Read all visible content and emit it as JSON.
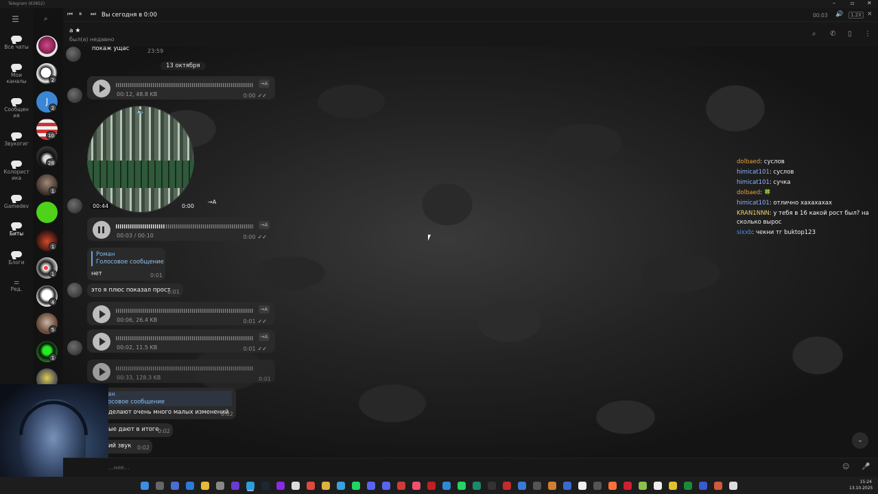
{
  "window": {
    "title": "Telegram (63852)",
    "minimize": "–",
    "maximize": "▫",
    "close": "✕"
  },
  "player": {
    "title": "Вы сегодня в 0:00",
    "elapsed": "00:03",
    "speed": "1.2X"
  },
  "chat_header": {
    "name": "a ★",
    "status": "был(а) недавно"
  },
  "folders": [
    {
      "label": "Все чаты"
    },
    {
      "label": "Мои каналы"
    },
    {
      "label": "Сообщения"
    },
    {
      "label": "Звукогиг"
    },
    {
      "label": "Колористика"
    },
    {
      "label": "Gamedev"
    },
    {
      "label": "Биты",
      "active": true
    },
    {
      "label": "Блоги"
    },
    {
      "label": "Ред."
    }
  ],
  "chat_badges": [
    "2",
    "2",
    "10",
    "28",
    "1",
    "1",
    "1",
    "4",
    "5",
    "1",
    "2"
  ],
  "messages": {
    "top_text": "покаж ущас",
    "top_time": "23:59",
    "date_divider": "13 октября",
    "voice1": {
      "meta": "00:12, 48.8 KB",
      "time": "0:00",
      "tr": "→A"
    },
    "video": {
      "duration": "00:44",
      "time": "0:00",
      "tr": "→A"
    },
    "voice2": {
      "meta": "00:03 / 00:10",
      "time": "0:00",
      "tr": "→A"
    },
    "reply1": {
      "name": "Роман",
      "text": "Голосовое сообщение",
      "body": "нет",
      "time": "0:01"
    },
    "text2": {
      "body": "это я плюс показал прост",
      "time": "0:01"
    },
    "voice3": {
      "meta": "00:06, 26.4 KB",
      "time": "0:01",
      "tr": "→A"
    },
    "voice4": {
      "meta": "00:02, 11.5 KB",
      "time": "0:01",
      "tr": "→A"
    },
    "voice5": {
      "meta": "00:33, 128.3 KB",
      "time": "0:01"
    },
    "reply2": {
      "name": "ан",
      "text": "осовое сообщение",
      "body": "делают очень много малых изменений",
      "time": "0:02"
    },
    "text3": {
      "body": "ые дают в итоге",
      "time": "0:02"
    },
    "text4": {
      "body": "ий звук",
      "time": "0:02"
    }
  },
  "stream_chat": [
    {
      "user": "dolbaed",
      "color": "#e8a13a",
      "text": "суслов"
    },
    {
      "user": "himicat101",
      "color": "#8fb6ff",
      "text": "суслов"
    },
    {
      "user": "himicat101",
      "color": "#8fb6ff",
      "text": "сучка"
    },
    {
      "user": "dolbaed",
      "color": "#e8a13a",
      "text": "🍀"
    },
    {
      "user": "himicat101",
      "color": "#8fb6ff",
      "text": "отлично хахахахах"
    },
    {
      "user": "KRAN1NNN",
      "color": "#f1d36b",
      "text": "у тебя в 16 какой рост был? на сколько вырос"
    },
    {
      "user": "sixxb",
      "color": "#4c8dff",
      "text": "чекни тг buktop123"
    }
  ],
  "composer": {
    "placeholder": "...ние..."
  },
  "taskbar": {
    "time": "15:24",
    "date": "13.10.2025"
  },
  "colors": {
    "accent": "#6aa6e3",
    "bubble": "#2a2a2a",
    "play": "#bdbdbd"
  }
}
